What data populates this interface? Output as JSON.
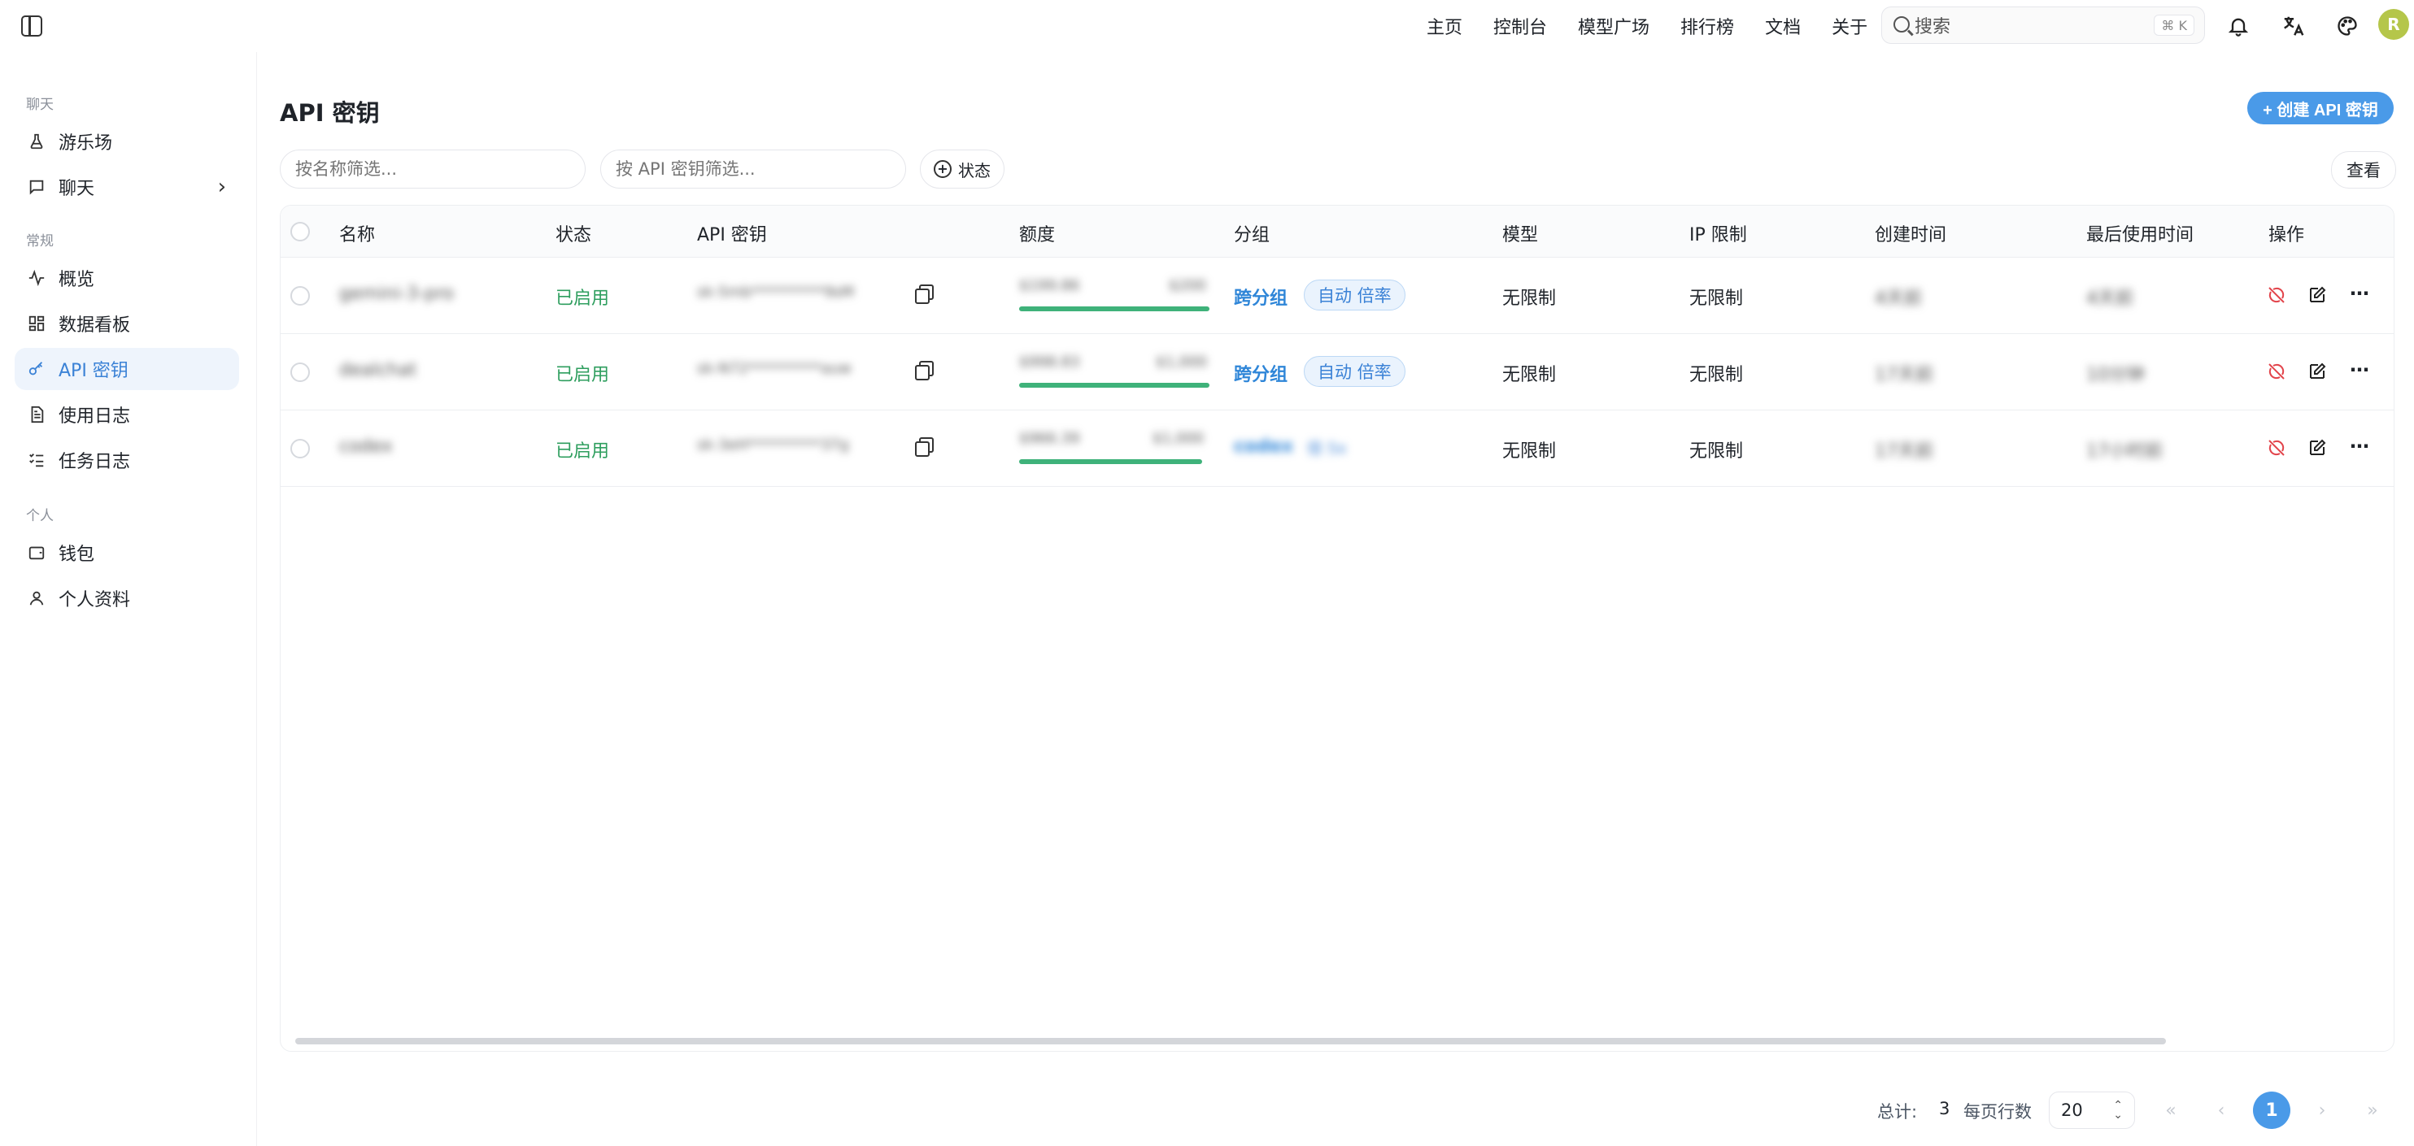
{
  "header": {
    "nav": [
      "主页",
      "控制台",
      "模型广场",
      "排行榜",
      "文档",
      "关于"
    ],
    "search_placeholder": "搜索",
    "search_shortcut": "⌘ K",
    "avatar_initial": "R"
  },
  "sidebar": {
    "sections": [
      {
        "title": "聊天",
        "items": [
          {
            "label": "游乐场",
            "icon": "flask-icon"
          },
          {
            "label": "聊天",
            "icon": "chat-icon"
          }
        ]
      },
      {
        "title": "常规",
        "items": [
          {
            "label": "概览",
            "icon": "activity-icon"
          },
          {
            "label": "数据看板",
            "icon": "dashboard-icon"
          },
          {
            "label": "API 密钥",
            "icon": "key-icon",
            "active": true
          },
          {
            "label": "使用日志",
            "icon": "document-icon"
          },
          {
            "label": "任务日志",
            "icon": "checklist-icon"
          }
        ]
      },
      {
        "title": "个人",
        "items": [
          {
            "label": "钱包",
            "icon": "wallet-icon"
          },
          {
            "label": "个人资料",
            "icon": "user-icon"
          }
        ]
      }
    ]
  },
  "main": {
    "title": "API 密钥",
    "create_button": "+ 创建 API 密钥",
    "filter_name_placeholder": "按名称筛选...",
    "filter_key_placeholder": "按 API 密钥筛选...",
    "status_filter": "状态",
    "view_button": "查看",
    "columns": [
      "名称",
      "状态",
      "API 密钥",
      "额度",
      "分组",
      "模型",
      "IP 限制",
      "创建时间",
      "最后使用时间",
      "操作"
    ],
    "rows": [
      {
        "name": "gemini-3-pro",
        "status": "已启用",
        "key": "sk-5mb**********9sM",
        "quota_used": "$199.86",
        "quota_total": "$200",
        "quota_fraction": 1.0,
        "group": "跨分组",
        "group_tag": "自动 倍率",
        "model": "无限制",
        "ip": "无限制",
        "created": "4天前",
        "last_used": "4天前"
      },
      {
        "name": "dealchat",
        "status": "已启用",
        "key": "sk-N72**********auw",
        "quota_used": "$998.83",
        "quota_total": "$1,000",
        "quota_fraction": 1.0,
        "group": "跨分组",
        "group_tag": "自动 倍率",
        "model": "无限制",
        "ip": "无限制",
        "created": "17天前",
        "last_used": "10分钟"
      },
      {
        "name": "codex",
        "status": "已启用",
        "key": "sk-3eH**********37g",
        "quota_used": "$966.39",
        "quota_total": "$1,000",
        "quota_fraction": 0.96,
        "group": "codex",
        "group_tag": "倍 5x",
        "model": "无限制",
        "ip": "无限制",
        "created": "17天前",
        "last_used": "17小时前"
      }
    ]
  },
  "pagination": {
    "total_label": "总计:",
    "total": "3",
    "per_page_label": "每页行数",
    "per_page": "20",
    "current_page": "1"
  },
  "colors": {
    "accent": "#4a9ae8",
    "success": "#2e9e5e",
    "danger": "#e2434a"
  }
}
